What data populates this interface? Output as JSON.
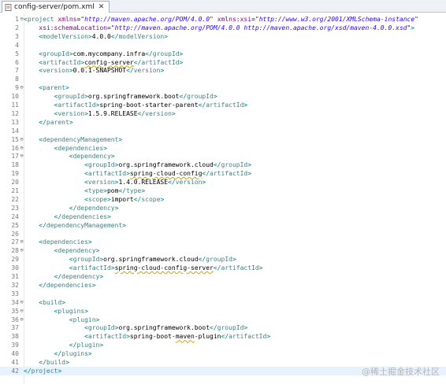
{
  "tab": {
    "label": "config-server/pom.xml",
    "close": "✕"
  },
  "watermark": "@稀土掘金技术社区",
  "lines": [
    {
      "n": "1",
      "fold": "⊖",
      "parts": [
        [
          "b",
          "<"
        ],
        [
          "t",
          "project"
        ],
        [
          "x",
          " "
        ],
        [
          "a",
          "xmlns"
        ],
        [
          "x",
          "="
        ],
        [
          "s",
          "\"http://maven.apache.org/POM/4.0.0\""
        ],
        [
          "x",
          " "
        ],
        [
          "a",
          "xmlns:xsi"
        ],
        [
          "x",
          "="
        ],
        [
          "s",
          "\"http://www.w3.org/2001/XMLSchema-instance\""
        ]
      ]
    },
    {
      "n": "2",
      "parts": [
        [
          "x",
          "    "
        ],
        [
          "a",
          "xsi:schemaLocation"
        ],
        [
          "x",
          "="
        ],
        [
          "s",
          "\"http://maven.apache.org/POM/4.0.0 http://maven.apache.org/xsd/maven-4.0.0.xsd\""
        ],
        [
          "b",
          ">"
        ]
      ]
    },
    {
      "n": "3",
      "parts": [
        [
          "x",
          "    "
        ],
        [
          "b",
          "<"
        ],
        [
          "t",
          "modelVersion"
        ],
        [
          "b",
          ">"
        ],
        [
          "x",
          "4.0.0"
        ],
        [
          "b",
          "</"
        ],
        [
          "t",
          "modelVersion"
        ],
        [
          "b",
          ">"
        ]
      ]
    },
    {
      "n": "4",
      "parts": []
    },
    {
      "n": "5",
      "parts": [
        [
          "x",
          "    "
        ],
        [
          "b",
          "<"
        ],
        [
          "t",
          "groupId"
        ],
        [
          "b",
          ">"
        ],
        [
          "x",
          "com.mycompany.infra"
        ],
        [
          "b",
          "</"
        ],
        [
          "t",
          "groupId"
        ],
        [
          "b",
          ">"
        ]
      ]
    },
    {
      "n": "6",
      "parts": [
        [
          "x",
          "    "
        ],
        [
          "b",
          "<"
        ],
        [
          "t",
          "artifactId"
        ],
        [
          "b",
          ">"
        ],
        [
          "q",
          "config-server"
        ],
        [
          "b",
          "</"
        ],
        [
          "t",
          "artifactId"
        ],
        [
          "b",
          ">"
        ]
      ]
    },
    {
      "n": "7",
      "parts": [
        [
          "x",
          "    "
        ],
        [
          "b",
          "<"
        ],
        [
          "t",
          "version"
        ],
        [
          "b",
          ">"
        ],
        [
          "x",
          "0.0.1-SNAPSHOT"
        ],
        [
          "b",
          "</"
        ],
        [
          "t",
          "version"
        ],
        [
          "b",
          ">"
        ]
      ]
    },
    {
      "n": "8",
      "parts": []
    },
    {
      "n": "9",
      "fold": "⊖",
      "parts": [
        [
          "x",
          "    "
        ],
        [
          "b",
          "<"
        ],
        [
          "t",
          "parent"
        ],
        [
          "b",
          ">"
        ]
      ]
    },
    {
      "n": "10",
      "parts": [
        [
          "x",
          "        "
        ],
        [
          "b",
          "<"
        ],
        [
          "t",
          "groupId"
        ],
        [
          "b",
          ">"
        ],
        [
          "x",
          "org.springframework.boot"
        ],
        [
          "b",
          "</"
        ],
        [
          "t",
          "groupId"
        ],
        [
          "b",
          ">"
        ]
      ]
    },
    {
      "n": "11",
      "parts": [
        [
          "x",
          "        "
        ],
        [
          "b",
          "<"
        ],
        [
          "t",
          "artifactId"
        ],
        [
          "b",
          ">"
        ],
        [
          "x",
          "spring-boot-starter-parent"
        ],
        [
          "b",
          "</"
        ],
        [
          "t",
          "artifactId"
        ],
        [
          "b",
          ">"
        ]
      ]
    },
    {
      "n": "12",
      "parts": [
        [
          "x",
          "        "
        ],
        [
          "b",
          "<"
        ],
        [
          "t",
          "version"
        ],
        [
          "b",
          ">"
        ],
        [
          "x",
          "1.5.9.RELEASE"
        ],
        [
          "b",
          "</"
        ],
        [
          "t",
          "version"
        ],
        [
          "b",
          ">"
        ]
      ]
    },
    {
      "n": "13",
      "parts": [
        [
          "x",
          "    "
        ],
        [
          "b",
          "</"
        ],
        [
          "t",
          "parent"
        ],
        [
          "b",
          ">"
        ]
      ]
    },
    {
      "n": "14",
      "parts": []
    },
    {
      "n": "15",
      "fold": "⊖",
      "parts": [
        [
          "x",
          "    "
        ],
        [
          "b",
          "<"
        ],
        [
          "t",
          "dependencyManagement"
        ],
        [
          "b",
          ">"
        ]
      ]
    },
    {
      "n": "16",
      "fold": "⊖",
      "parts": [
        [
          "x",
          "        "
        ],
        [
          "b",
          "<"
        ],
        [
          "t",
          "dependencies"
        ],
        [
          "b",
          ">"
        ]
      ]
    },
    {
      "n": "17",
      "fold": "⊖",
      "parts": [
        [
          "x",
          "            "
        ],
        [
          "b",
          "<"
        ],
        [
          "t",
          "dependency"
        ],
        [
          "b",
          ">"
        ]
      ]
    },
    {
      "n": "18",
      "parts": [
        [
          "x",
          "                "
        ],
        [
          "b",
          "<"
        ],
        [
          "t",
          "groupId"
        ],
        [
          "b",
          ">"
        ],
        [
          "x",
          "org.springframework.cloud"
        ],
        [
          "b",
          "</"
        ],
        [
          "t",
          "groupId"
        ],
        [
          "b",
          ">"
        ]
      ]
    },
    {
      "n": "19",
      "parts": [
        [
          "x",
          "                "
        ],
        [
          "b",
          "<"
        ],
        [
          "t",
          "artifactId"
        ],
        [
          "b",
          ">"
        ],
        [
          "q",
          "spring-cloud-config"
        ],
        [
          "b",
          "</"
        ],
        [
          "t",
          "artifactId"
        ],
        [
          "b",
          ">"
        ]
      ]
    },
    {
      "n": "20",
      "parts": [
        [
          "x",
          "                "
        ],
        [
          "b",
          "<"
        ],
        [
          "t",
          "version"
        ],
        [
          "b",
          ">"
        ],
        [
          "x",
          "1.4.0.RELEASE"
        ],
        [
          "b",
          "</"
        ],
        [
          "t",
          "version"
        ],
        [
          "b",
          ">"
        ]
      ]
    },
    {
      "n": "21",
      "parts": [
        [
          "x",
          "                "
        ],
        [
          "b",
          "<"
        ],
        [
          "t",
          "type"
        ],
        [
          "b",
          ">"
        ],
        [
          "x",
          "pom"
        ],
        [
          "b",
          "</"
        ],
        [
          "t",
          "type"
        ],
        [
          "b",
          ">"
        ]
      ]
    },
    {
      "n": "22",
      "parts": [
        [
          "x",
          "                "
        ],
        [
          "b",
          "<"
        ],
        [
          "t",
          "scope"
        ],
        [
          "b",
          ">"
        ],
        [
          "x",
          "import"
        ],
        [
          "b",
          "</"
        ],
        [
          "t",
          "scope"
        ],
        [
          "b",
          ">"
        ]
      ]
    },
    {
      "n": "23",
      "parts": [
        [
          "x",
          "            "
        ],
        [
          "b",
          "</"
        ],
        [
          "t",
          "dependency"
        ],
        [
          "b",
          ">"
        ]
      ]
    },
    {
      "n": "24",
      "parts": [
        [
          "x",
          "        "
        ],
        [
          "b",
          "</"
        ],
        [
          "t",
          "dependencies"
        ],
        [
          "b",
          ">"
        ]
      ]
    },
    {
      "n": "25",
      "parts": [
        [
          "x",
          "    "
        ],
        [
          "b",
          "</"
        ],
        [
          "t",
          "dependencyManagement"
        ],
        [
          "b",
          ">"
        ]
      ]
    },
    {
      "n": "26",
      "parts": []
    },
    {
      "n": "27",
      "fold": "⊖",
      "parts": [
        [
          "x",
          "    "
        ],
        [
          "b",
          "<"
        ],
        [
          "t",
          "dependencies"
        ],
        [
          "b",
          ">"
        ]
      ]
    },
    {
      "n": "28",
      "fold": "⊖",
      "parts": [
        [
          "x",
          "        "
        ],
        [
          "b",
          "<"
        ],
        [
          "t",
          "dependency"
        ],
        [
          "b",
          ">"
        ]
      ]
    },
    {
      "n": "29",
      "parts": [
        [
          "x",
          "            "
        ],
        [
          "b",
          "<"
        ],
        [
          "t",
          "groupId"
        ],
        [
          "b",
          ">"
        ],
        [
          "x",
          "org.springframework.cloud"
        ],
        [
          "b",
          "</"
        ],
        [
          "t",
          "groupId"
        ],
        [
          "b",
          ">"
        ]
      ]
    },
    {
      "n": "30",
      "parts": [
        [
          "x",
          "            "
        ],
        [
          "b",
          "<"
        ],
        [
          "t",
          "artifactId"
        ],
        [
          "b",
          ">"
        ],
        [
          "q",
          "spring-cloud-config-server"
        ],
        [
          "b",
          "</"
        ],
        [
          "t",
          "artifactId"
        ],
        [
          "b",
          ">"
        ]
      ]
    },
    {
      "n": "31",
      "parts": [
        [
          "x",
          "        "
        ],
        [
          "b",
          "</"
        ],
        [
          "t",
          "dependency"
        ],
        [
          "b",
          ">"
        ]
      ]
    },
    {
      "n": "32",
      "parts": [
        [
          "x",
          "    "
        ],
        [
          "b",
          "</"
        ],
        [
          "t",
          "dependencies"
        ],
        [
          "b",
          ">"
        ]
      ]
    },
    {
      "n": "33",
      "parts": []
    },
    {
      "n": "34",
      "fold": "⊖",
      "parts": [
        [
          "x",
          "    "
        ],
        [
          "b",
          "<"
        ],
        [
          "t",
          "build"
        ],
        [
          "b",
          ">"
        ]
      ]
    },
    {
      "n": "35",
      "fold": "⊖",
      "parts": [
        [
          "x",
          "        "
        ],
        [
          "b",
          "<"
        ],
        [
          "t",
          "plugins"
        ],
        [
          "b",
          ">"
        ]
      ]
    },
    {
      "n": "36",
      "fold": "⊖",
      "parts": [
        [
          "x",
          "            "
        ],
        [
          "b",
          "<"
        ],
        [
          "t",
          "plugin"
        ],
        [
          "b",
          ">"
        ]
      ]
    },
    {
      "n": "37",
      "parts": [
        [
          "x",
          "                "
        ],
        [
          "b",
          "<"
        ],
        [
          "t",
          "groupId"
        ],
        [
          "b",
          ">"
        ],
        [
          "x",
          "org.springframework.boot"
        ],
        [
          "b",
          "</"
        ],
        [
          "t",
          "groupId"
        ],
        [
          "b",
          ">"
        ]
      ]
    },
    {
      "n": "38",
      "parts": [
        [
          "x",
          "                "
        ],
        [
          "b",
          "<"
        ],
        [
          "t",
          "artifactId"
        ],
        [
          "b",
          ">"
        ],
        [
          "x",
          "spring-boot-"
        ],
        [
          "q",
          "maven"
        ],
        [
          "x",
          "-plugin"
        ],
        [
          "b",
          "</"
        ],
        [
          "t",
          "artifactId"
        ],
        [
          "b",
          ">"
        ]
      ]
    },
    {
      "n": "39",
      "parts": [
        [
          "x",
          "            "
        ],
        [
          "b",
          "</"
        ],
        [
          "t",
          "plugin"
        ],
        [
          "b",
          ">"
        ]
      ]
    },
    {
      "n": "40",
      "parts": [
        [
          "x",
          "        "
        ],
        [
          "b",
          "</"
        ],
        [
          "t",
          "plugins"
        ],
        [
          "b",
          ">"
        ]
      ]
    },
    {
      "n": "41",
      "parts": [
        [
          "x",
          "    "
        ],
        [
          "b",
          "</"
        ],
        [
          "t",
          "build"
        ],
        [
          "b",
          ">"
        ]
      ]
    },
    {
      "n": "42",
      "current": true,
      "parts": [
        [
          "b",
          "</"
        ],
        [
          "t",
          "project"
        ],
        [
          "b",
          ">"
        ]
      ]
    }
  ]
}
